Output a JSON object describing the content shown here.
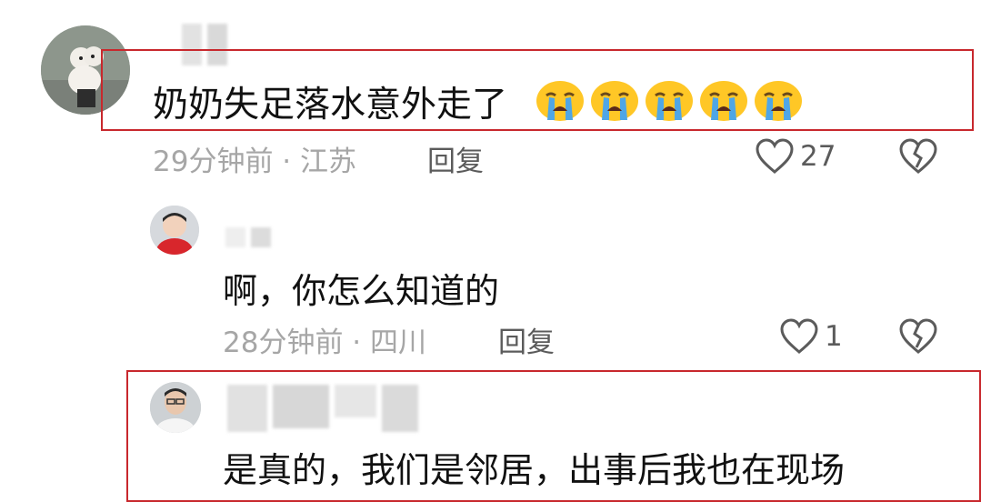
{
  "comments": [
    {
      "text": "奶奶失足落水意外走了",
      "emoji_icon": "loudly-crying-face-icon",
      "emoji_count": 5,
      "time": "29分钟前 · 江苏",
      "reply_label": "回复",
      "like_count": "27"
    },
    {
      "text": "啊，你怎么知道的",
      "time": "28分钟前 · 四川",
      "reply_label": "回复",
      "like_count": "1"
    },
    {
      "text": "是真的，我们是邻居，出事后我也在现场"
    }
  ],
  "colors": {
    "highlight_border": "#c8282d",
    "meta_text": "#a6a6a6",
    "action_text": "#5b5b5b"
  }
}
